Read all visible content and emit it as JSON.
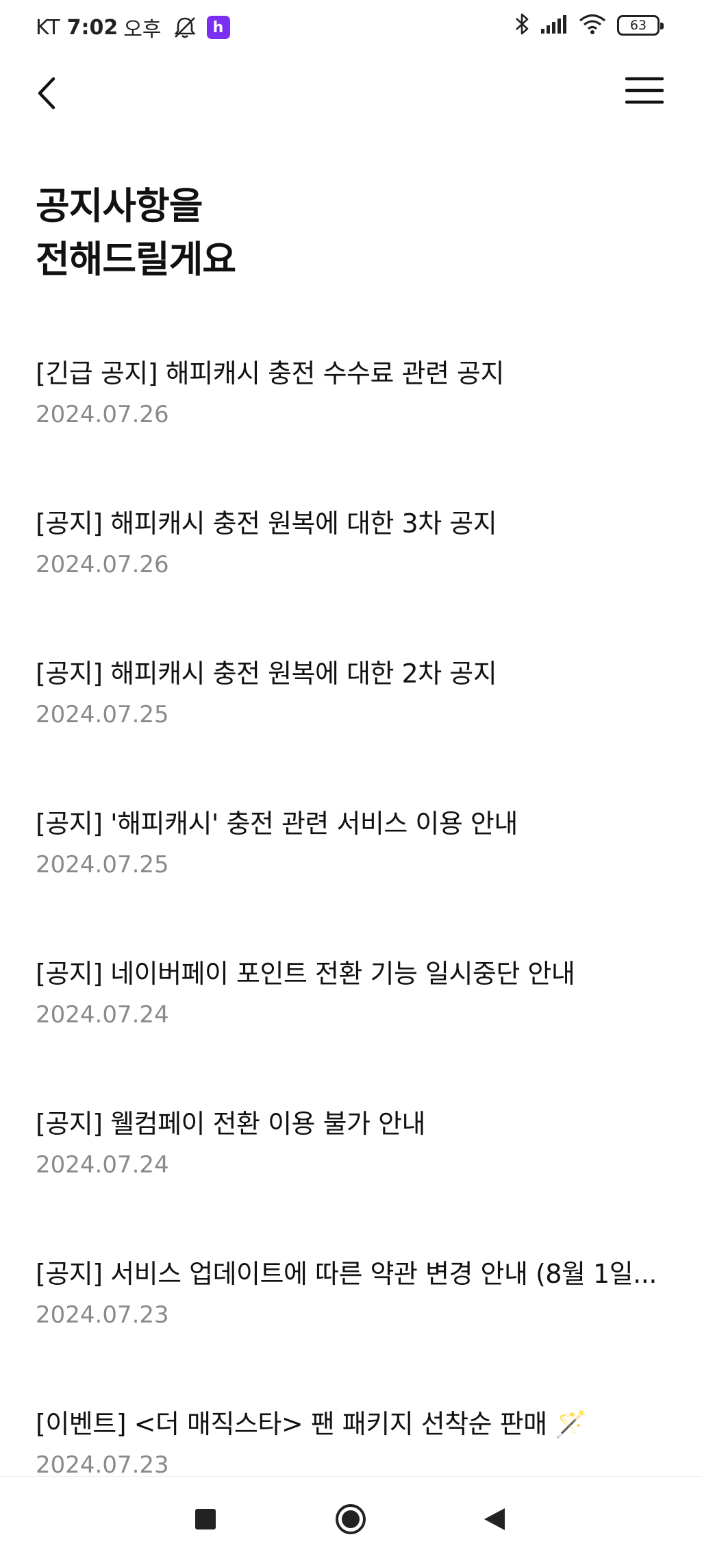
{
  "status_bar": {
    "carrier": "KT",
    "time": "7:02",
    "ampm": "오후",
    "app_badge": "h",
    "battery": "63"
  },
  "icons": {
    "back": "chevron-left-icon",
    "menu": "hamburger-menu-icon",
    "mute": "bell-off-icon",
    "bluetooth": "bluetooth-icon",
    "signal": "signal-icon",
    "wifi": "wifi-icon"
  },
  "colors": {
    "title_text": "#111111",
    "date_text": "#8a8a8a",
    "app_badge": "#7b2ff0"
  },
  "page": {
    "title_line1": "공지사항을",
    "title_line2": "전해드릴게요"
  },
  "notices": [
    {
      "title": "[긴급 공지] 해피캐시 충전 수수료 관련 공지",
      "date": "2024.07.26"
    },
    {
      "title": "[공지] 해피캐시 충전 원복에 대한 3차 공지",
      "date": "2024.07.26"
    },
    {
      "title": "[공지] 해피캐시 충전 원복에 대한 2차 공지",
      "date": "2024.07.25"
    },
    {
      "title": "[공지] '해피캐시' 충전 관련 서비스 이용 안내",
      "date": "2024.07.25"
    },
    {
      "title": "[공지] 네이버페이 포인트 전환 기능 일시중단 안내",
      "date": "2024.07.24"
    },
    {
      "title": "[공지] 웰컴페이 전환 이용 불가 안내",
      "date": "2024.07.24"
    },
    {
      "title": "[공지] 서비스 업데이트에 따른 약관 변경 안내 (8월 1일...",
      "date": "2024.07.23"
    },
    {
      "title": "[이벤트] <더 매직스타> 팬 패키지 선착순 판매 🪄",
      "date": "2024.07.23"
    }
  ],
  "nav_bar": {
    "recents": "recents-square-icon",
    "home": "home-circle-icon",
    "back": "back-triangle-icon"
  }
}
